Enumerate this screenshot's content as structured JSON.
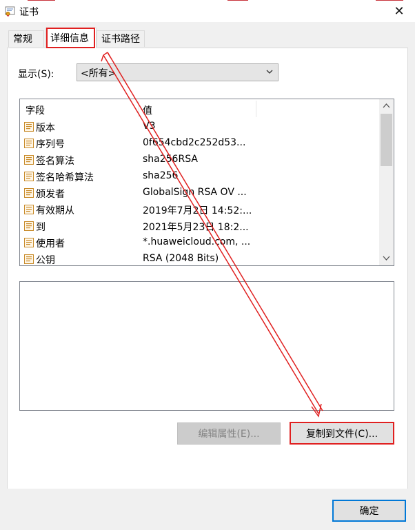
{
  "window": {
    "title": "证书",
    "close_glyph": "✕",
    "icon": "certificate-icon"
  },
  "tabs": [
    {
      "label": "常规",
      "active": false
    },
    {
      "label": "详细信息",
      "active": true
    },
    {
      "label": "证书路径",
      "active": false
    }
  ],
  "show": {
    "label": "显示(S):",
    "value": "<所有>"
  },
  "list": {
    "columns": [
      "字段",
      "值"
    ],
    "rows": [
      {
        "field": "版本",
        "value": "V3"
      },
      {
        "field": "序列号",
        "value": "0f654cbd2c252d53..."
      },
      {
        "field": "签名算法",
        "value": "sha256RSA"
      },
      {
        "field": "签名哈希算法",
        "value": "sha256"
      },
      {
        "field": "颁发者",
        "value": "GlobalSign RSA OV ..."
      },
      {
        "field": "有效期从",
        "value": "2019年7月2日 14:52:..."
      },
      {
        "field": "到",
        "value": "2021年5月23日 18:2..."
      },
      {
        "field": "使用者",
        "value": "*.huaweicloud.com, ..."
      },
      {
        "field": "公钥",
        "value": "RSA (2048 Bits)"
      }
    ]
  },
  "buttons": {
    "edit_properties": "编辑属性(E)...",
    "copy_to_file": "复制到文件(C)...",
    "ok": "确定"
  },
  "colors": {
    "highlight": "#e02020",
    "focus_border": "#0078d7",
    "dialog_bg": "#f0f0f0"
  }
}
